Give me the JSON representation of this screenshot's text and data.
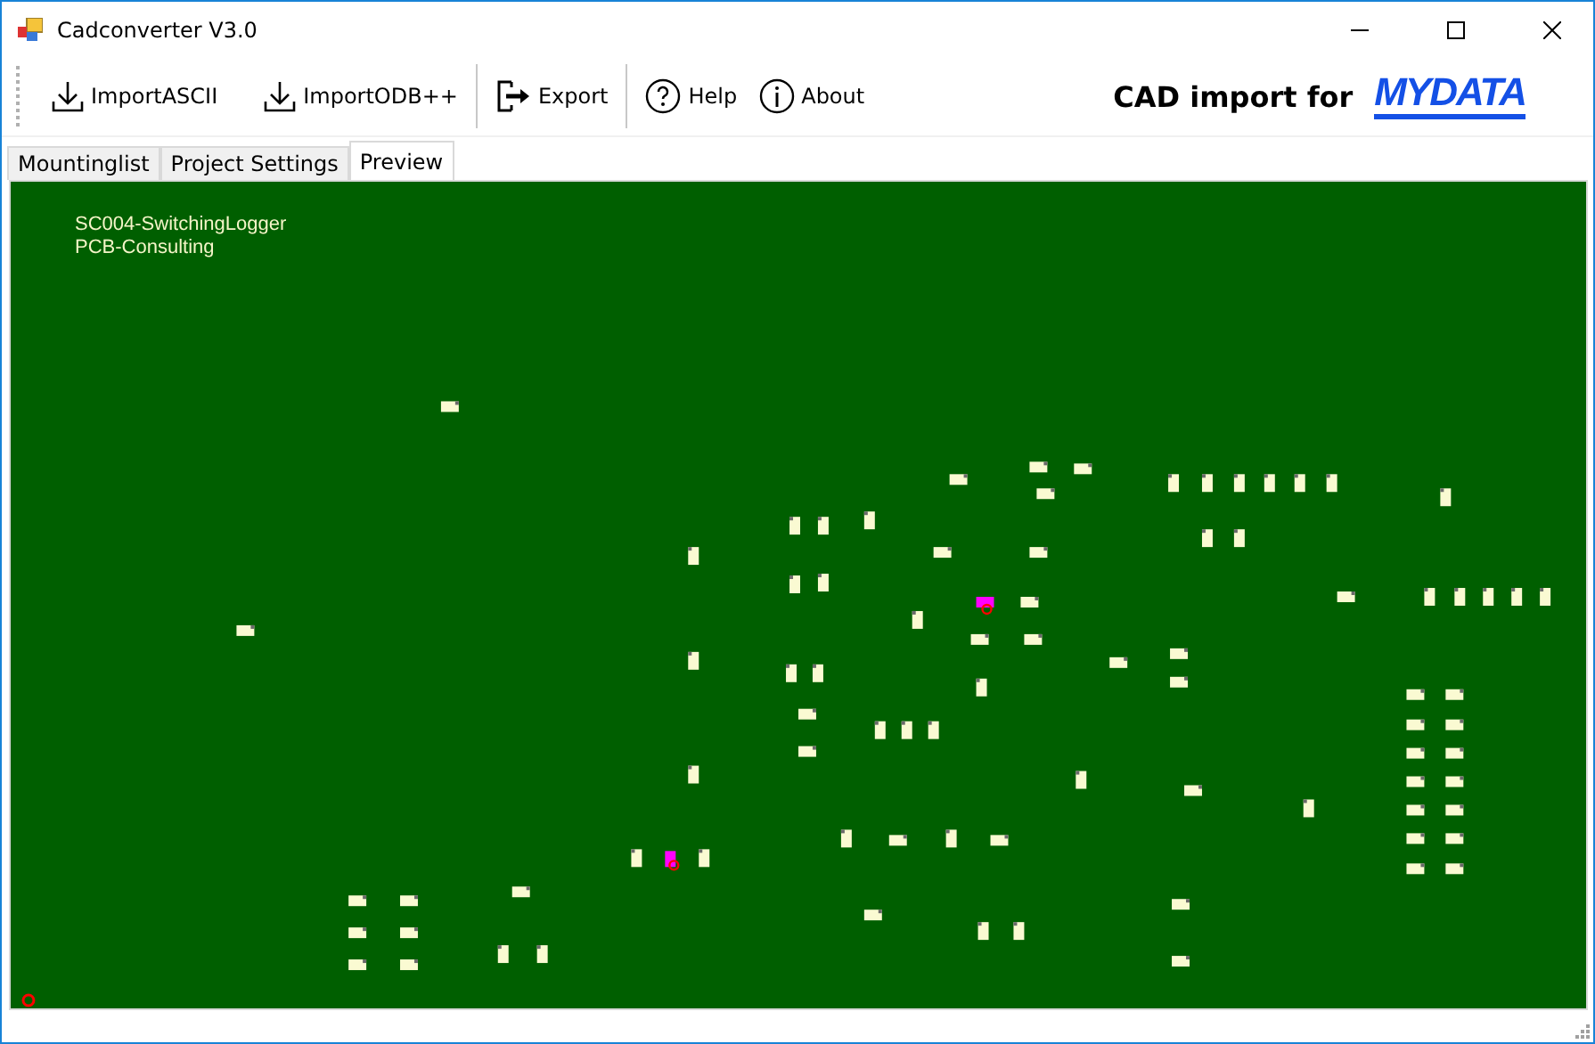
{
  "window": {
    "title": "Cadconverter V3.0"
  },
  "toolbar": {
    "groups": [
      [
        {
          "label": "ImportASCII",
          "kind": "download"
        },
        {
          "label": "ImportODB++",
          "kind": "download"
        }
      ],
      [
        {
          "label": "Export",
          "kind": "export"
        }
      ],
      [
        {
          "label": "Help",
          "kind": "help"
        },
        {
          "label": "About",
          "kind": "info"
        }
      ]
    ],
    "tagline": "CAD import for",
    "logo": "MYDATA"
  },
  "tabs": [
    {
      "label": "Mountinglist",
      "selected": false
    },
    {
      "label": "Project Settings",
      "selected": false
    },
    {
      "label": "Preview",
      "selected": true
    }
  ],
  "preview": {
    "lines": [
      "SC004-SwitchingLogger",
      "PCB-Consulting"
    ]
  }
}
